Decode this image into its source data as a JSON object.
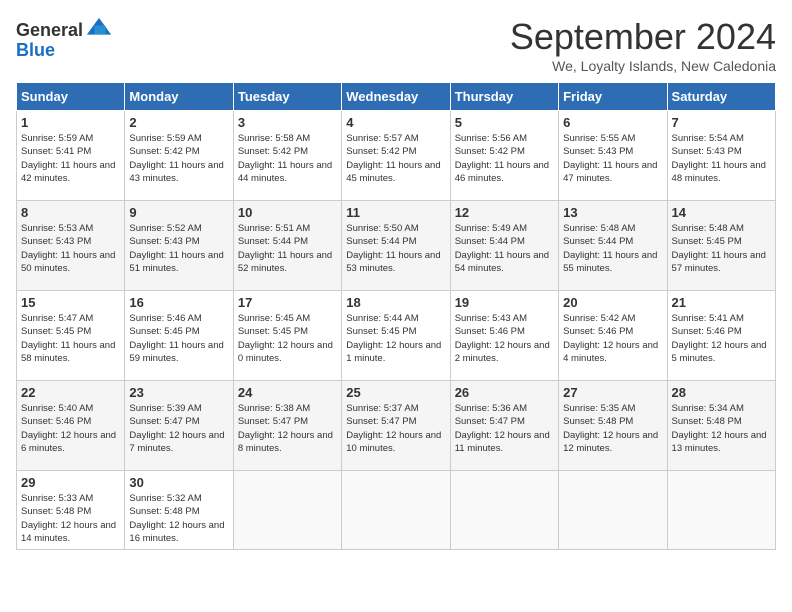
{
  "logo": {
    "general": "General",
    "blue": "Blue"
  },
  "title": "September 2024",
  "location": "We, Loyalty Islands, New Caledonia",
  "weekdays": [
    "Sunday",
    "Monday",
    "Tuesday",
    "Wednesday",
    "Thursday",
    "Friday",
    "Saturday"
  ],
  "weeks": [
    [
      {
        "day": 1,
        "sunrise": "5:59 AM",
        "sunset": "5:41 PM",
        "daylight": "11 hours and 42 minutes."
      },
      {
        "day": 2,
        "sunrise": "5:59 AM",
        "sunset": "5:42 PM",
        "daylight": "11 hours and 43 minutes."
      },
      {
        "day": 3,
        "sunrise": "5:58 AM",
        "sunset": "5:42 PM",
        "daylight": "11 hours and 44 minutes."
      },
      {
        "day": 4,
        "sunrise": "5:57 AM",
        "sunset": "5:42 PM",
        "daylight": "11 hours and 45 minutes."
      },
      {
        "day": 5,
        "sunrise": "5:56 AM",
        "sunset": "5:42 PM",
        "daylight": "11 hours and 46 minutes."
      },
      {
        "day": 6,
        "sunrise": "5:55 AM",
        "sunset": "5:43 PM",
        "daylight": "11 hours and 47 minutes."
      },
      {
        "day": 7,
        "sunrise": "5:54 AM",
        "sunset": "5:43 PM",
        "daylight": "11 hours and 48 minutes."
      }
    ],
    [
      {
        "day": 8,
        "sunrise": "5:53 AM",
        "sunset": "5:43 PM",
        "daylight": "11 hours and 50 minutes."
      },
      {
        "day": 9,
        "sunrise": "5:52 AM",
        "sunset": "5:43 PM",
        "daylight": "11 hours and 51 minutes."
      },
      {
        "day": 10,
        "sunrise": "5:51 AM",
        "sunset": "5:44 PM",
        "daylight": "11 hours and 52 minutes."
      },
      {
        "day": 11,
        "sunrise": "5:50 AM",
        "sunset": "5:44 PM",
        "daylight": "11 hours and 53 minutes."
      },
      {
        "day": 12,
        "sunrise": "5:49 AM",
        "sunset": "5:44 PM",
        "daylight": "11 hours and 54 minutes."
      },
      {
        "day": 13,
        "sunrise": "5:48 AM",
        "sunset": "5:44 PM",
        "daylight": "11 hours and 55 minutes."
      },
      {
        "day": 14,
        "sunrise": "5:48 AM",
        "sunset": "5:45 PM",
        "daylight": "11 hours and 57 minutes."
      }
    ],
    [
      {
        "day": 15,
        "sunrise": "5:47 AM",
        "sunset": "5:45 PM",
        "daylight": "11 hours and 58 minutes."
      },
      {
        "day": 16,
        "sunrise": "5:46 AM",
        "sunset": "5:45 PM",
        "daylight": "11 hours and 59 minutes."
      },
      {
        "day": 17,
        "sunrise": "5:45 AM",
        "sunset": "5:45 PM",
        "daylight": "12 hours and 0 minutes."
      },
      {
        "day": 18,
        "sunrise": "5:44 AM",
        "sunset": "5:45 PM",
        "daylight": "12 hours and 1 minute."
      },
      {
        "day": 19,
        "sunrise": "5:43 AM",
        "sunset": "5:46 PM",
        "daylight": "12 hours and 2 minutes."
      },
      {
        "day": 20,
        "sunrise": "5:42 AM",
        "sunset": "5:46 PM",
        "daylight": "12 hours and 4 minutes."
      },
      {
        "day": 21,
        "sunrise": "5:41 AM",
        "sunset": "5:46 PM",
        "daylight": "12 hours and 5 minutes."
      }
    ],
    [
      {
        "day": 22,
        "sunrise": "5:40 AM",
        "sunset": "5:46 PM",
        "daylight": "12 hours and 6 minutes."
      },
      {
        "day": 23,
        "sunrise": "5:39 AM",
        "sunset": "5:47 PM",
        "daylight": "12 hours and 7 minutes."
      },
      {
        "day": 24,
        "sunrise": "5:38 AM",
        "sunset": "5:47 PM",
        "daylight": "12 hours and 8 minutes."
      },
      {
        "day": 25,
        "sunrise": "5:37 AM",
        "sunset": "5:47 PM",
        "daylight": "12 hours and 10 minutes."
      },
      {
        "day": 26,
        "sunrise": "5:36 AM",
        "sunset": "5:47 PM",
        "daylight": "12 hours and 11 minutes."
      },
      {
        "day": 27,
        "sunrise": "5:35 AM",
        "sunset": "5:48 PM",
        "daylight": "12 hours and 12 minutes."
      },
      {
        "day": 28,
        "sunrise": "5:34 AM",
        "sunset": "5:48 PM",
        "daylight": "12 hours and 13 minutes."
      }
    ],
    [
      {
        "day": 29,
        "sunrise": "5:33 AM",
        "sunset": "5:48 PM",
        "daylight": "12 hours and 14 minutes."
      },
      {
        "day": 30,
        "sunrise": "5:32 AM",
        "sunset": "5:48 PM",
        "daylight": "12 hours and 16 minutes."
      },
      null,
      null,
      null,
      null,
      null
    ]
  ]
}
